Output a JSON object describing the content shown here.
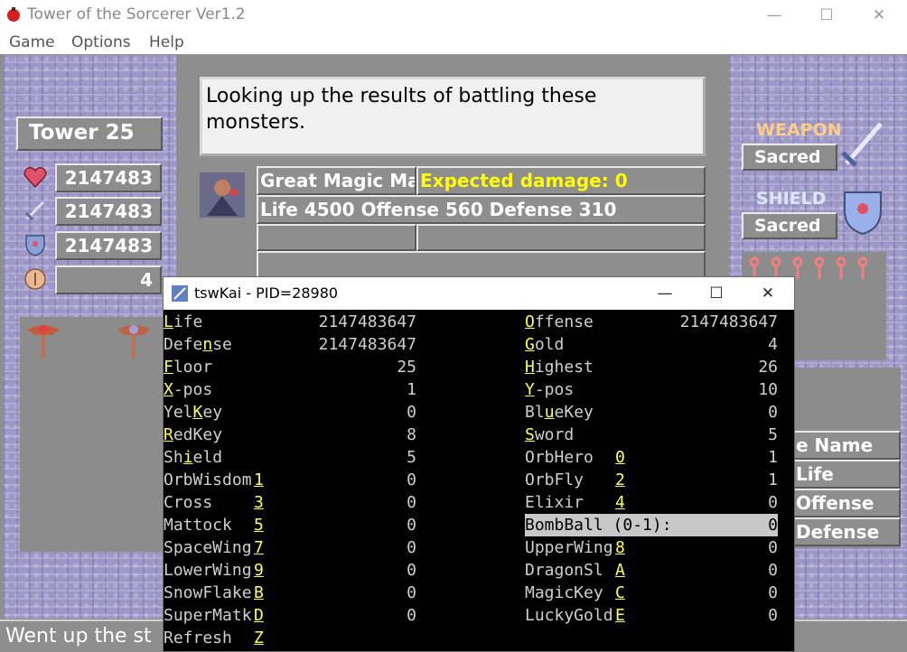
{
  "main": {
    "title": "Tower of the Sorcerer Ver1.2",
    "menus": [
      "Game",
      "Options",
      "Help"
    ],
    "floor_label": "Tower 25",
    "stats": {
      "life": "2147483",
      "offense": "2147483",
      "defense": "2147483",
      "gold": "4"
    },
    "message": "Looking up the results of battling these monsters.",
    "monster_name": "Great Magic Ma",
    "expected_damage": "Expected damage: 0",
    "monster_stats": "Life 4500 Offense 560 Defense 310",
    "weapon_label": "WEAPON",
    "weapon_value": "Sacred",
    "shield_label": "SHIELD",
    "shield_value": "Sacred",
    "side_table": {
      "name": "e Name",
      "life": "Life",
      "offense": "Offense",
      "defense": "Defense"
    },
    "status": "Went up the st",
    "colors": {
      "stone": "#9d98c8",
      "gray": "#8e8e8e",
      "yellow": "#ffff00"
    }
  },
  "kai": {
    "title": "tswKai - PID=28980",
    "left": [
      {
        "pre": "",
        "key": "L",
        "post": "ife",
        "badge": "",
        "value": "2147483647"
      },
      {
        "pre": "Defe",
        "key": "n",
        "post": "se",
        "badge": "",
        "value": "2147483647"
      },
      {
        "pre": "",
        "key": "F",
        "post": "loor",
        "badge": "",
        "value": "25"
      },
      {
        "pre": "",
        "key": "X",
        "post": "-pos",
        "badge": "",
        "value": "1"
      },
      {
        "pre": "Yel",
        "key": "K",
        "post": "ey",
        "badge": "",
        "value": "0"
      },
      {
        "pre": "",
        "key": "R",
        "post": "edKey",
        "badge": "",
        "value": "8"
      },
      {
        "pre": "Sh",
        "key": "i",
        "post": "eld",
        "badge": "",
        "value": "5"
      },
      {
        "pre": "OrbWisdom",
        "key": "",
        "post": "",
        "badge": "1",
        "value": "0"
      },
      {
        "pre": "Cross",
        "key": "",
        "post": "",
        "badge": "3",
        "value": "0"
      },
      {
        "pre": "Mattock",
        "key": "",
        "post": "",
        "badge": "5",
        "value": "0"
      },
      {
        "pre": "SpaceWing",
        "key": "",
        "post": "",
        "badge": "7",
        "value": "0"
      },
      {
        "pre": "LowerWing",
        "key": "",
        "post": "",
        "badge": "9",
        "value": "0"
      },
      {
        "pre": "SnowFlake",
        "key": "",
        "post": "",
        "badge": "B",
        "value": "0"
      },
      {
        "pre": "SuperMatk",
        "key": "",
        "post": "",
        "badge": "D",
        "value": "0"
      },
      {
        "pre": "Refresh",
        "key": "",
        "post": "",
        "badge": "Z",
        "value": ""
      }
    ],
    "right": [
      {
        "pre": "",
        "key": "O",
        "post": "ffense",
        "badge": "",
        "value": "2147483647"
      },
      {
        "pre": "",
        "key": "G",
        "post": "old",
        "badge": "",
        "value": "4"
      },
      {
        "pre": "",
        "key": "H",
        "post": "ighest",
        "badge": "",
        "value": "26"
      },
      {
        "pre": "",
        "key": "Y",
        "post": "-pos",
        "badge": "",
        "value": "10"
      },
      {
        "pre": "Bl",
        "key": "u",
        "post": "eKey",
        "badge": "",
        "value": "0"
      },
      {
        "pre": "",
        "key": "S",
        "post": "word",
        "badge": "",
        "value": "5"
      },
      {
        "pre": "OrbHero",
        "key": "",
        "post": "",
        "badge": "0",
        "value": "1"
      },
      {
        "pre": "OrbFly",
        "key": "",
        "post": "",
        "badge": "2",
        "value": "1"
      },
      {
        "pre": "Elixir",
        "key": "",
        "post": "",
        "badge": "4",
        "value": "0"
      },
      {
        "pre": "BombBall (0-1):",
        "key": "",
        "post": "",
        "badge": "",
        "value": "0"
      },
      {
        "pre": "UpperWing",
        "key": "",
        "post": "",
        "badge": "8",
        "value": "0"
      },
      {
        "pre": "DragonSl",
        "key": "",
        "post": "",
        "badge": "A",
        "value": "0"
      },
      {
        "pre": "MagicKey",
        "key": "",
        "post": "",
        "badge": "C",
        "value": "0"
      },
      {
        "pre": "LuckyGold",
        "key": "",
        "post": "",
        "badge": "E",
        "value": "0"
      }
    ]
  }
}
